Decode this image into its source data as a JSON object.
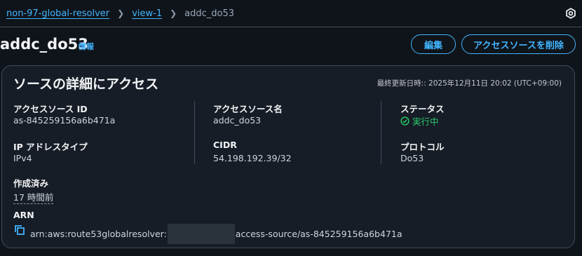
{
  "breadcrumb": {
    "items": [
      "non-97-global-resolver",
      "view-1"
    ],
    "current": "addc_do53"
  },
  "header": {
    "title": "addc_do53",
    "info_link": "情報",
    "edit_label": "編集",
    "delete_label": "アクセスソースを削除"
  },
  "card": {
    "title": "ソースの詳細にアクセス",
    "last_updated": "最終更新日時:: 2025年12月11日 20:02 (UTC+09:00)",
    "fields": {
      "access_source_id": {
        "label": "アクセスソース ID",
        "value": "as-845259156a6b471a"
      },
      "access_source_name": {
        "label": "アクセスソース名",
        "value": "addc_do53"
      },
      "status": {
        "label": "ステータス",
        "value": "実行中"
      },
      "ip_address_type": {
        "label": "IP アドレスタイプ",
        "value": "IPv4"
      },
      "cidr": {
        "label": "CIDR",
        "value": "54.198.192.39/32"
      },
      "protocol": {
        "label": "プロトコル",
        "value": "Do53"
      },
      "created": {
        "label": "作成済み",
        "value": "17 時間前"
      },
      "arn": {
        "label": "ARN",
        "prefix": "arn:aws:route53globalresolver:",
        "suffix": "access-source/as-845259156a6b471a"
      }
    }
  },
  "colors": {
    "background": "#0f141a",
    "card": "#161d26",
    "link": "#42b4ff",
    "success": "#29c96b",
    "border": "#414d5c"
  },
  "icons": [
    "chevron-right-icon",
    "settings-icon",
    "status-success-icon",
    "copy-icon"
  ]
}
